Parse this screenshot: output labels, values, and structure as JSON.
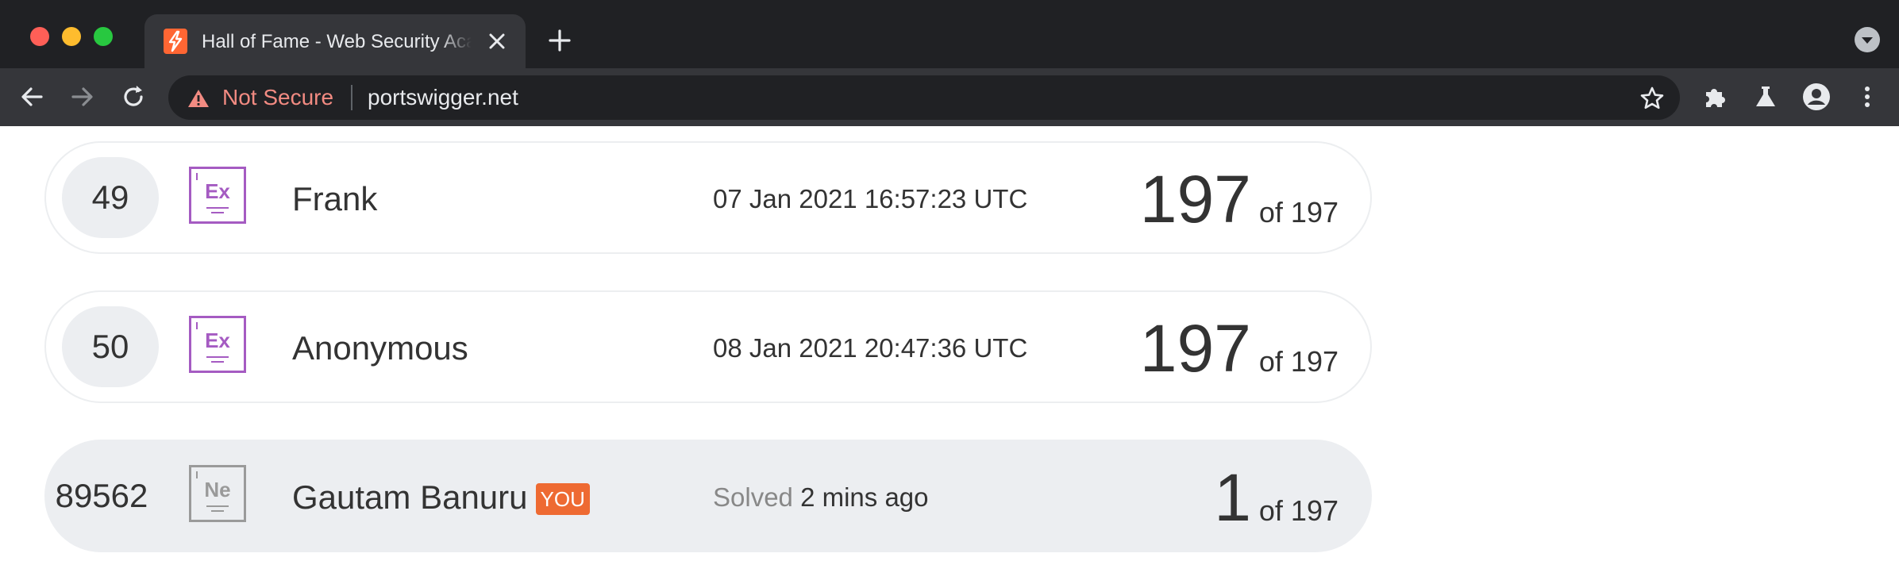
{
  "browser": {
    "tab_title": "Hall of Fame - Web Security Academy",
    "security_label": "Not Secure",
    "url": "portswigger.net"
  },
  "leaderboard": [
    {
      "rank": "49",
      "level": "Ex",
      "name": "Frank",
      "date": "07 Jan 2021 16:57:23 UTC",
      "solved": "197",
      "of_label": "of 197",
      "is_you": false
    },
    {
      "rank": "50",
      "level": "Ex",
      "name": "Anonymous",
      "date": "08 Jan 2021 20:47:36 UTC",
      "solved": "197",
      "of_label": "of 197",
      "is_you": false
    },
    {
      "rank": "89562",
      "level": "Ne",
      "name": "Gautam Banuru",
      "you_badge": "YOU",
      "solved_prefix": "Solved",
      "date": "2 mins ago",
      "solved": "1",
      "of_label": "of 197",
      "is_you": true
    }
  ],
  "colors": {
    "expert_level": "#a55bc2",
    "newbie_level": "#9a9a9a",
    "you_badge": "#ee6a32",
    "not_secure": "#f28b82"
  }
}
